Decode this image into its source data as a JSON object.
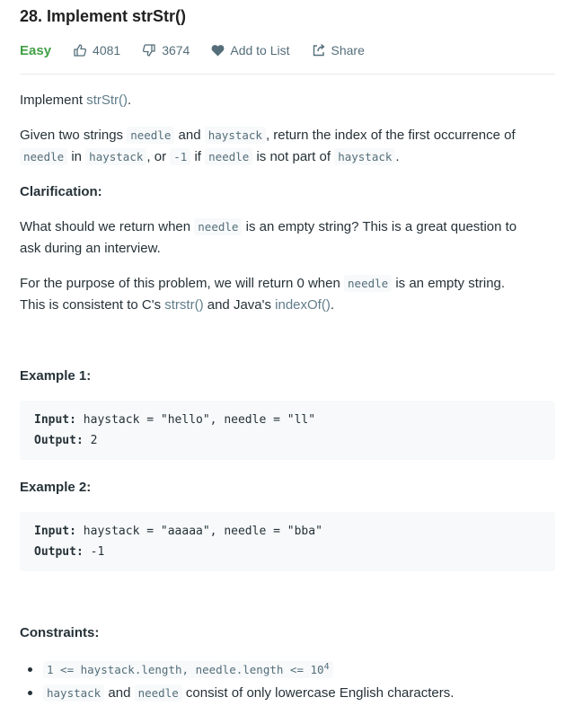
{
  "problem": {
    "title": "28. Implement strStr()",
    "difficulty": "Easy",
    "likes": "4081",
    "dislikes": "3674",
    "add_to_list": "Add to List",
    "share": "Share"
  },
  "description": {
    "intro_prefix": "Implement ",
    "intro_link": "strStr()",
    "intro_suffix": ".",
    "given_1": "Given two strings ",
    "code_needle": "needle",
    "and": " and ",
    "code_haystack": "haystack",
    "given_2": ", return the index of the first occurrence of",
    "in": " in ",
    "comma_or": ", or ",
    "code_minus_one": "-1",
    "if": " if ",
    "not_part_of": " is not part of ",
    "period": ".",
    "clarification_heading": "Clarification:",
    "clar_1": "What should we return when ",
    "clar_2": " is an empty string? This is a great question to",
    "clar_3": "ask during an interview.",
    "purpose_1": "For the purpose of this problem, we will return 0 when ",
    "purpose_2": " is an empty string.",
    "purpose_3": "This is consistent to C's ",
    "strstr_link": "strstr()",
    "and_javas": " and Java's ",
    "indexof_link": "indexOf()",
    "period2": "."
  },
  "examples": [
    {
      "heading": "Example 1:",
      "input_label": "Input:",
      "input_value": " haystack = \"hello\", needle = \"ll\"",
      "output_label": "Output:",
      "output_value": " 2"
    },
    {
      "heading": "Example 2:",
      "input_label": "Input:",
      "input_value": " haystack = \"aaaaa\", needle = \"bba\"",
      "output_label": "Output:",
      "output_value": " -1"
    }
  ],
  "constraints": {
    "heading": "Constraints:",
    "c1": "1 <= haystack.length, needle.length <= 10",
    "c1_sup": "4",
    "c2_a": "haystack",
    "c2_and": " and ",
    "c2_b": "needle",
    "c2_rest": " consist of only lowercase English characters."
  },
  "colors": {
    "easy": "#43a047",
    "text": "#263238",
    "muted": "#546e7a",
    "code_bg": "#f7f9fa"
  }
}
